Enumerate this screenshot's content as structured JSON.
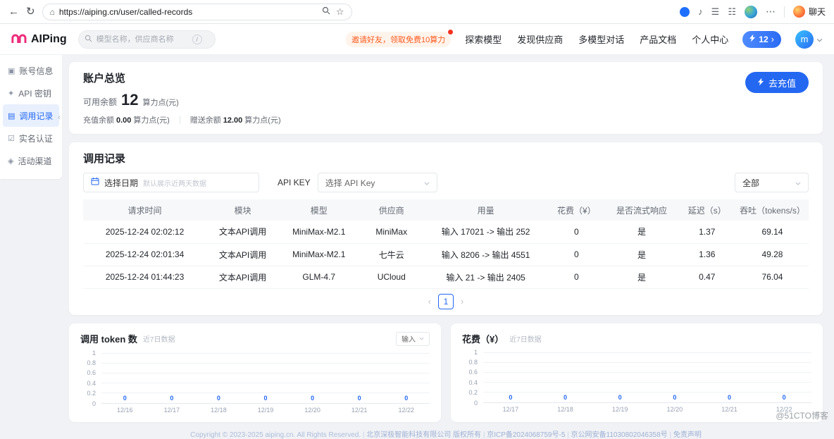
{
  "browser": {
    "url": "https://aiping.cn/user/called-records",
    "chat_label": "聊天"
  },
  "icons": {
    "back": "←",
    "reload": "↻",
    "home": "⌂",
    "star": "☆",
    "music": "♪",
    "list": "☰",
    "grid": "☷",
    "ellipsis": "⋯",
    "prev": "‹",
    "next": "›",
    "chevron_right": "›",
    "collapse": "‹"
  },
  "header": {
    "logo": "AIPing",
    "search": {
      "placeholder": "模型名称，供应商名称",
      "shortcut": "/"
    },
    "promo": "邀请好友，领取免费10算力",
    "nav": [
      {
        "key": "explore-models",
        "label": "探索模型"
      },
      {
        "key": "find-providers",
        "label": "发现供应商"
      },
      {
        "key": "multi-model-chat",
        "label": "多模型对话"
      },
      {
        "key": "product-docs",
        "label": "产品文档"
      },
      {
        "key": "user-center",
        "label": "个人中心"
      }
    ],
    "credits": "12",
    "avatar": "m"
  },
  "sidebar": {
    "items": [
      {
        "key": "account-info",
        "label": "账号信息",
        "icon": "id-card-icon",
        "glyph": "▣",
        "active": false
      },
      {
        "key": "api-keys",
        "label": "API 密钥",
        "icon": "key-icon",
        "glyph": "✦",
        "active": false
      },
      {
        "key": "call-records",
        "label": "调用记录",
        "icon": "document-icon",
        "glyph": "▤",
        "active": true
      },
      {
        "key": "identity-verify",
        "label": "实名认证",
        "icon": "badge-check-icon",
        "glyph": "☑",
        "active": false
      },
      {
        "key": "activity-channel",
        "label": "活动渠道",
        "icon": "gift-icon",
        "glyph": "◈",
        "active": false
      }
    ]
  },
  "overview": {
    "title": "账户总览",
    "recharge_button": "去充值",
    "available_label": "可用余额",
    "available_value": "12",
    "available_unit": "算力点(元)",
    "recharge_balance_label": "充值余额",
    "recharge_balance_value": "0.00",
    "recharge_balance_unit": "算力点(元)",
    "gift_balance_label": "赠送余额",
    "gift_balance_value": "12.00",
    "gift_balance_unit": "算力点(元)"
  },
  "records": {
    "title": "调用记录",
    "date_label": "选择日期",
    "date_hint": "默认展示近两天数据",
    "apikey_label": "API KEY",
    "apikey_placeholder": "选择 API Key",
    "filter_all": "全部",
    "columns": [
      "请求时间",
      "模块",
      "模型",
      "供应商",
      "用量",
      "花费（¥）",
      "是否流式响应",
      "延迟（s）",
      "吞吐（tokens/s）"
    ],
    "rows": [
      [
        "2025-12-24 02:02:12",
        "文本API调用",
        "MiniMax-M2.1",
        "MiniMax",
        "输入 17021 -> 输出 252",
        "0",
        "是",
        "1.37",
        "69.14"
      ],
      [
        "2025-12-24 02:01:34",
        "文本API调用",
        "MiniMax-M2.1",
        "七牛云",
        "输入 8206 -> 输出 4551",
        "0",
        "是",
        "1.36",
        "49.28"
      ],
      [
        "2025-12-24 01:44:23",
        "文本API调用",
        "GLM-4.7",
        "UCloud",
        "输入 21 -> 输出 2405",
        "0",
        "是",
        "0.47",
        "76.04"
      ]
    ],
    "page": "1"
  },
  "chart_data": [
    {
      "type": "line",
      "title": "调用 token 数",
      "subtitle": "近7日数据",
      "selector": "输入",
      "categories": [
        "12/16",
        "12/17",
        "12/18",
        "12/19",
        "12/20",
        "12/21",
        "12/22"
      ],
      "values": [
        0,
        0,
        0,
        0,
        0,
        0,
        0
      ],
      "yticks": [
        1,
        0.8,
        0.6,
        0.4,
        0.2,
        0
      ],
      "ylim": [
        0,
        1
      ],
      "grid": true,
      "legend": "none"
    },
    {
      "type": "line",
      "title": "花费（¥）",
      "subtitle": "近7日数据",
      "categories": [
        "12/17",
        "12/18",
        "12/19",
        "12/20",
        "12/21",
        "12/22"
      ],
      "values": [
        0,
        0,
        0,
        0,
        0,
        0
      ],
      "yticks": [
        1,
        0.8,
        0.6,
        0.4,
        0.2,
        0
      ],
      "ylim": [
        0,
        1
      ],
      "grid": true,
      "legend": "none"
    }
  ],
  "footer": {
    "copyright": "Copyright © 2023-2025 aiping.cn. All Rights Reserved.",
    "links": [
      "北京深极智能科技有限公司 版权所有",
      "京ICP备2024068759号-5",
      "京公网安备11030802046358号",
      "免责声明"
    ]
  },
  "watermark": "@51CTO博客",
  "colors": {
    "accent": "#2468F2"
  }
}
